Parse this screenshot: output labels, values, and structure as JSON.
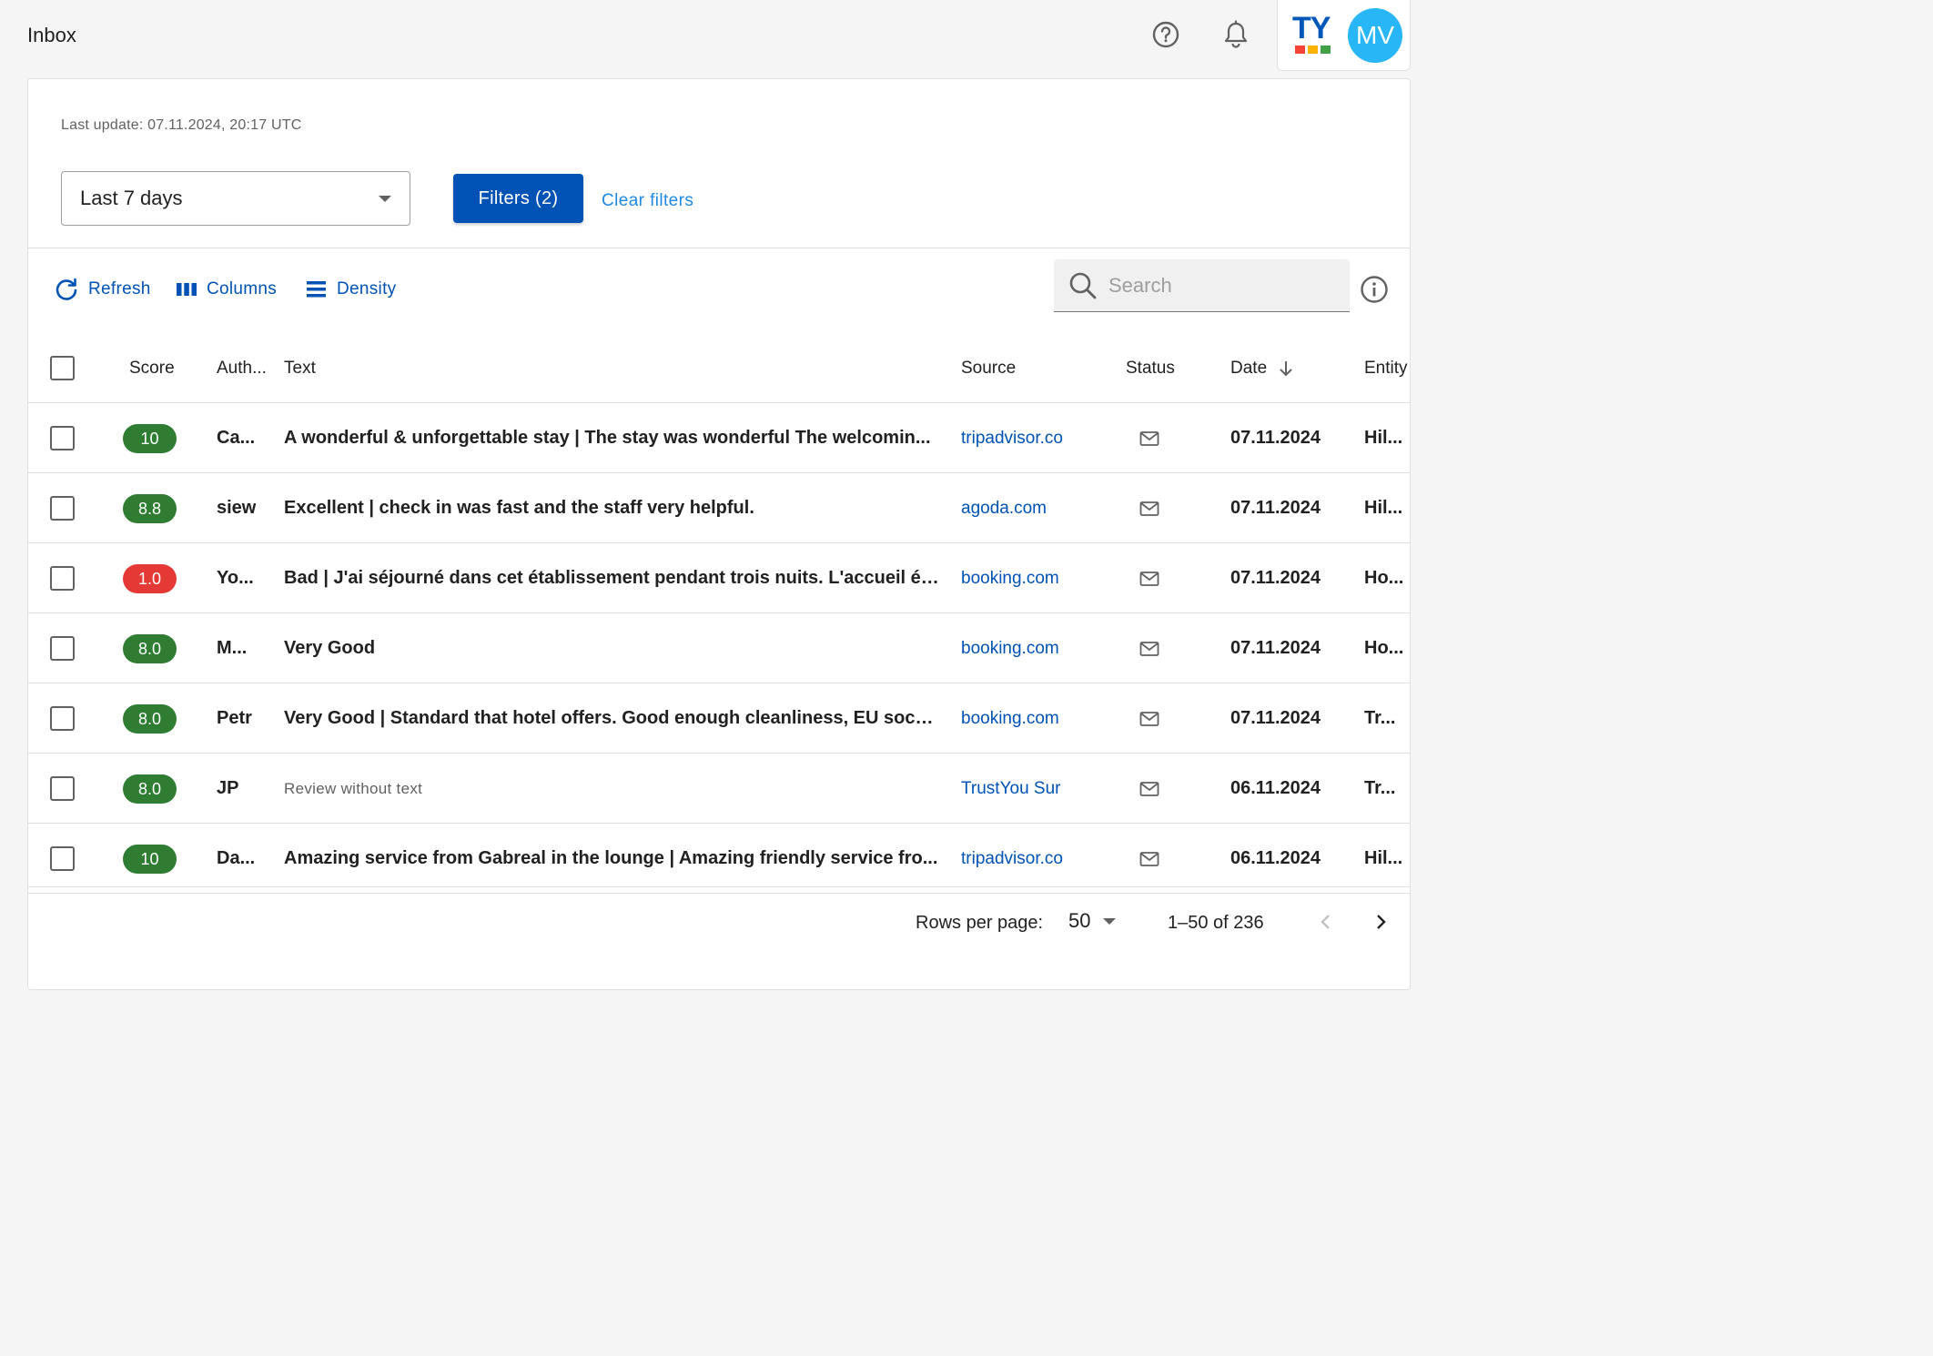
{
  "header": {
    "title": "Inbox",
    "help_icon": "help-circle-icon",
    "bell_icon": "bell-icon",
    "logo_text": "TY",
    "logo_colors": [
      "#f44336",
      "#ffb300",
      "#43a047"
    ],
    "avatar_initials": "MV",
    "avatar_color": "#29b6f6"
  },
  "filters": {
    "last_update": "Last update: 07.11.2024, 20:17 UTC",
    "period_value": "Last 7 days",
    "filters_button": "Filters (2)",
    "clear_filters": "Clear filters"
  },
  "toolbar": {
    "refresh": "Refresh",
    "columns": "Columns",
    "density": "Density",
    "search_placeholder": "Search"
  },
  "table": {
    "columns": {
      "score": "Score",
      "author": "Auth...",
      "text": "Text",
      "source": "Source",
      "status": "Status",
      "date": "Date",
      "entity": "Entity"
    },
    "rows": [
      {
        "score": "10",
        "score_color": "#2e7d32",
        "author": "Ca...",
        "text": "A wonderful & unforgettable stay | The stay was wonderful The welcomin...",
        "muted": false,
        "source": "tripadvisor.co",
        "status": "mail-icon",
        "date": "07.11.2024",
        "entity": "Hil..."
      },
      {
        "score": "8.8",
        "score_color": "#2e7d32",
        "author": "siew",
        "text": "Excellent | check in was fast and the staff very helpful.",
        "muted": false,
        "source": "agoda.com",
        "status": "mail-icon",
        "date": "07.11.2024",
        "entity": "Hil..."
      },
      {
        "score": "1.0",
        "score_color": "#e53935",
        "author": "Yo...",
        "text": "Bad | J'ai séjourné dans cet établissement pendant trois nuits. L'accueil ét...",
        "muted": false,
        "source": "booking.com",
        "status": "mail-icon",
        "date": "07.11.2024",
        "entity": "Ho..."
      },
      {
        "score": "8.0",
        "score_color": "#2e7d32",
        "author": "M...",
        "text": "Very Good",
        "muted": false,
        "source": "booking.com",
        "status": "mail-icon",
        "date": "07.11.2024",
        "entity": "Ho..."
      },
      {
        "score": "8.0",
        "score_color": "#2e7d32",
        "author": "Petr",
        "text": "Very Good | Standard that hotel offers. Good enough cleanliness, EU sock...",
        "muted": false,
        "source": "booking.com",
        "status": "mail-icon",
        "date": "07.11.2024",
        "entity": "Tr..."
      },
      {
        "score": "8.0",
        "score_color": "#2e7d32",
        "author": "JP",
        "text": "Review without text",
        "muted": true,
        "source": "TrustYou Sur",
        "status": "mail-icon",
        "date": "06.11.2024",
        "entity": "Tr..."
      },
      {
        "score": "10",
        "score_color": "#2e7d32",
        "author": "Da...",
        "text": "Amazing service from Gabreal in the lounge | Amazing friendly service fro...",
        "muted": false,
        "source": "tripadvisor.co",
        "status": "mail-icon",
        "date": "06.11.2024",
        "entity": "Hil..."
      }
    ]
  },
  "pagination": {
    "rows_per_page_label": "Rows per page:",
    "rows_per_page": "50",
    "range": "1–50 of 236"
  }
}
